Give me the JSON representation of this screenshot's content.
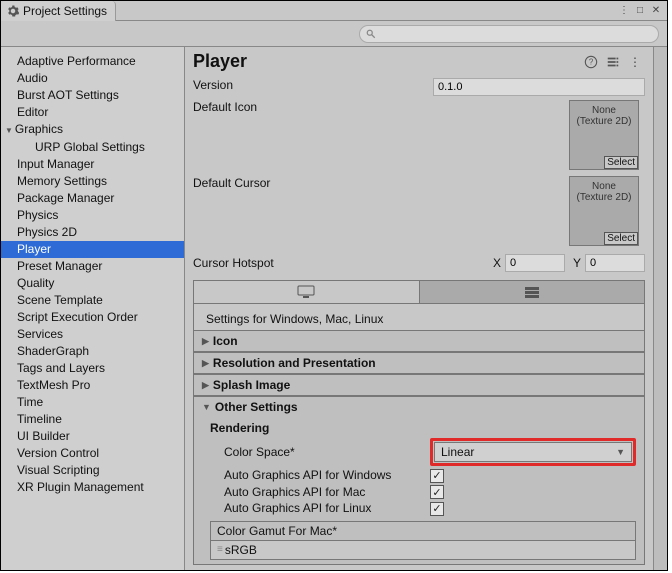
{
  "window": {
    "title": "Project Settings"
  },
  "sidebar": {
    "items": [
      {
        "label": "Adaptive Performance"
      },
      {
        "label": "Audio"
      },
      {
        "label": "Burst AOT Settings"
      },
      {
        "label": "Editor"
      },
      {
        "label": "Graphics",
        "haschild": true
      },
      {
        "label": "URP Global Settings",
        "child": true
      },
      {
        "label": "Input Manager"
      },
      {
        "label": "Memory Settings"
      },
      {
        "label": "Package Manager"
      },
      {
        "label": "Physics"
      },
      {
        "label": "Physics 2D"
      },
      {
        "label": "Player",
        "selected": true
      },
      {
        "label": "Preset Manager"
      },
      {
        "label": "Quality"
      },
      {
        "label": "Scene Template"
      },
      {
        "label": "Script Execution Order"
      },
      {
        "label": "Services"
      },
      {
        "label": "ShaderGraph"
      },
      {
        "label": "Tags and Layers"
      },
      {
        "label": "TextMesh Pro"
      },
      {
        "label": "Time"
      },
      {
        "label": "Timeline"
      },
      {
        "label": "UI Builder"
      },
      {
        "label": "Version Control"
      },
      {
        "label": "Visual Scripting"
      },
      {
        "label": "XR Plugin Management"
      }
    ]
  },
  "player": {
    "title": "Player",
    "version_label": "Version",
    "version_value": "0.1.0",
    "default_icon_label": "Default Icon",
    "default_cursor_label": "Default Cursor",
    "cursor_hotspot_label": "Cursor Hotspot",
    "hotspot_x_label": "X",
    "hotspot_x_value": "0",
    "hotspot_y_label": "Y",
    "hotspot_y_value": "0",
    "texslot_none": "None\n(Texture 2D)",
    "texslot_select": "Select",
    "settings_label": "Settings for Windows, Mac, Linux",
    "fold_icon": "Icon",
    "fold_resolution": "Resolution and Presentation",
    "fold_splash": "Splash Image",
    "fold_other": "Other Settings",
    "rendering": "Rendering",
    "color_space_label": "Color Space*",
    "color_space_value": "Linear",
    "auto_win": "Auto Graphics API  for Windows",
    "auto_mac": "Auto Graphics API  for Mac",
    "auto_linux": "Auto Graphics API  for Linux",
    "gamut_header": "Color Gamut For Mac*",
    "gamut_item": "sRGB"
  }
}
